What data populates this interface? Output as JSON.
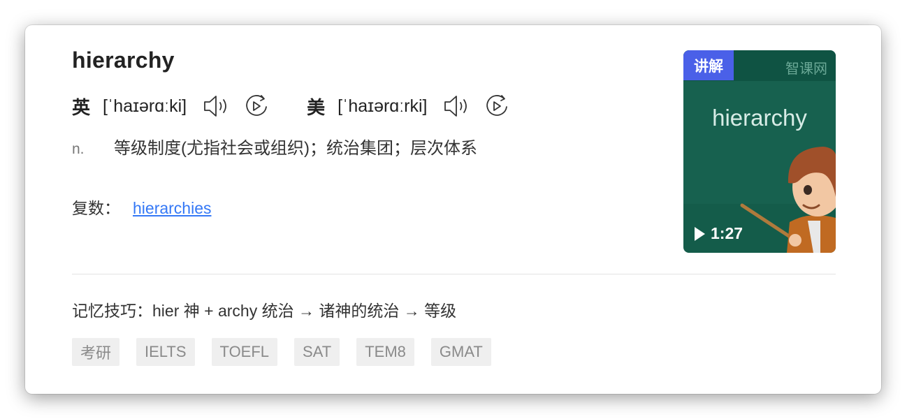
{
  "entry": {
    "word": "hierarchy",
    "uk": {
      "label": "英",
      "phonetic": "[ˈhaɪərɑːki]"
    },
    "us": {
      "label": "美",
      "phonetic": "[ˈhaɪərɑːrki]"
    },
    "definition": {
      "pos": "n.",
      "text": "等级制度(尤指社会或组织)；统治集团；层次体系"
    },
    "plural": {
      "label": "复数：",
      "value": "hierarchies"
    }
  },
  "video": {
    "badge": "讲解",
    "brand": "智课网",
    "title_word": "hierarchy",
    "duration": "1:27"
  },
  "memory_tip": "记忆技巧：hier 神 + archy 统治 → 诸神的统治 → 等级",
  "tags": [
    "考研",
    "IELTS",
    "TOEFL",
    "SAT",
    "TEM8",
    "GMAT"
  ],
  "icons": {
    "speaker": "speaker-icon",
    "replay": "replay-icon",
    "play": "play-icon"
  },
  "colors": {
    "link": "#3478f6",
    "badge": "#4a60e8",
    "video_bg": "#17614f"
  }
}
